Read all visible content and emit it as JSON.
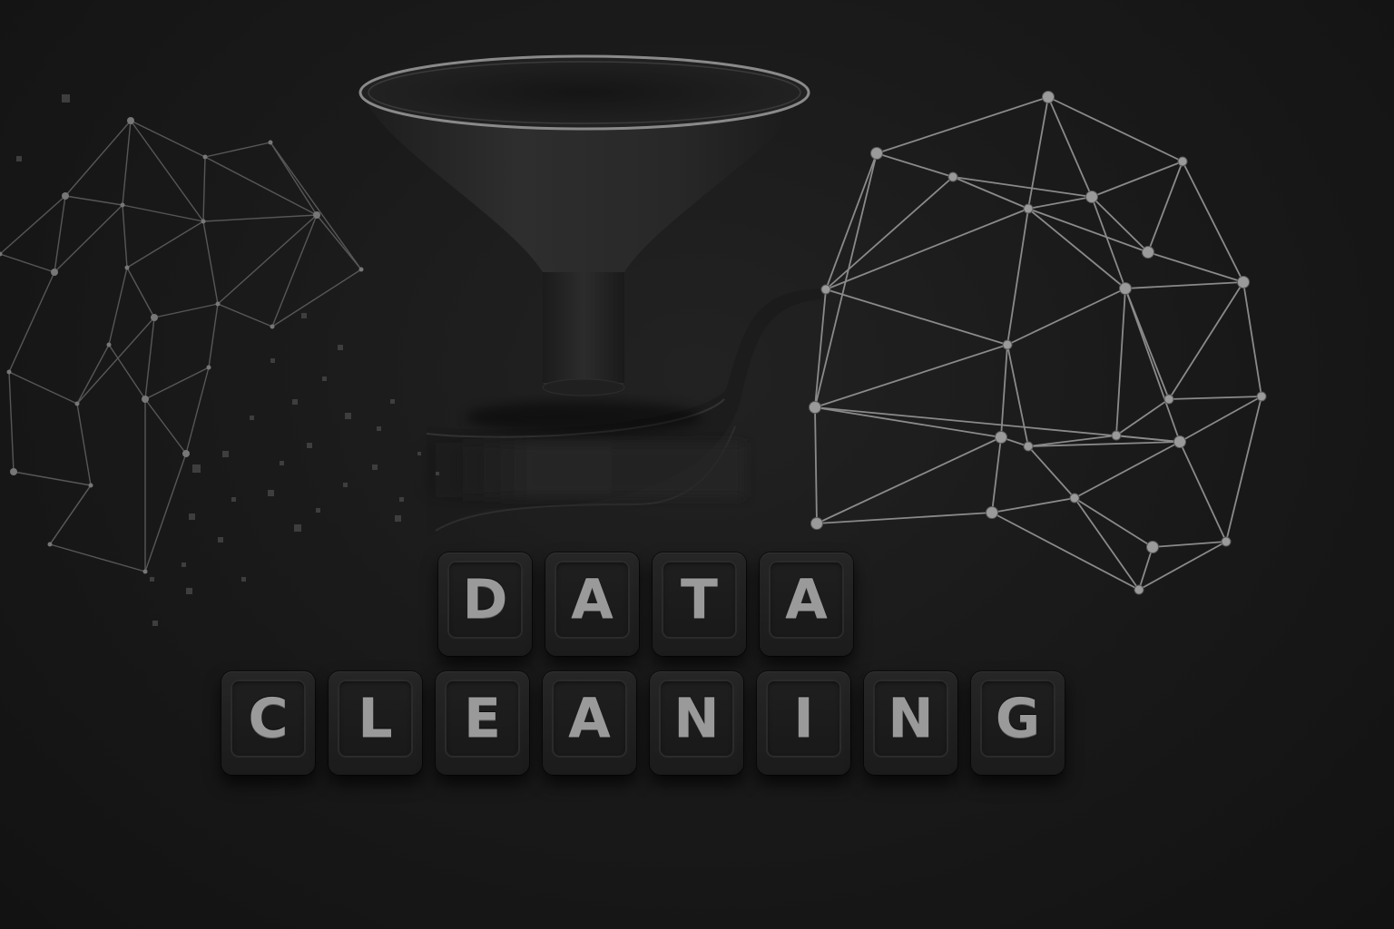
{
  "headline": {
    "line1": [
      "D",
      "A",
      "T",
      "A"
    ],
    "line2": [
      "C",
      "L",
      "E",
      "A",
      "N",
      "I",
      "N",
      "G"
    ]
  },
  "colors": {
    "background": "#161616",
    "tile": "#1f1f1f",
    "letter": "#9a9a9a",
    "network_line": "#7a7a7a",
    "funnel": "#2c2c2c"
  },
  "icons": [
    "messy-network-icon",
    "funnel-icon",
    "clean-network-icon",
    "data-particles-icon"
  ]
}
